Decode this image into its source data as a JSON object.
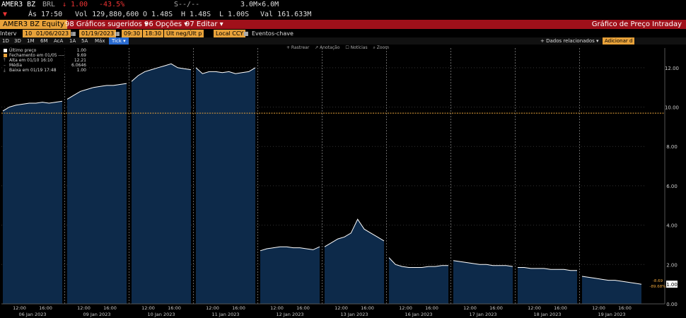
{
  "ticker": {
    "symbol": "AMER3 BZ",
    "currency": "BRL",
    "arrow": "↓",
    "price": "1.00",
    "change_pct": "-43.5%",
    "bid_ask": "S--/--",
    "size": "3.0M×6.0M"
  },
  "row2": {
    "time_label": "Ás 17:50",
    "volume": "Vol 129,880,600",
    "open": "O 1.48S",
    "high": "H 1.48S",
    "low": "L 1.00S",
    "value": "Val 161.633M"
  },
  "titlebar": {
    "security": "AMER3 BZ Equity",
    "menu": [
      "98 Gráficos sugeridos ▾",
      "96 Opções ▾",
      "97 Editar ▾"
    ],
    "title": "Gráfico de Preço Intraday"
  },
  "params": {
    "interval_label": "Interv",
    "interval": "10",
    "start_date": "01/06/2023",
    "end_date": "01/19/2023",
    "start_time": "09:30",
    "end_time": "18:30",
    "price_type": "Últ neg/Últ p",
    "currency": "Local CCY",
    "events": "Eventos-chave"
  },
  "periods": {
    "items": [
      "1D",
      "3D",
      "1M",
      "6M",
      "AcA",
      "1A",
      "5A",
      "Máx"
    ],
    "tick_label": "Tick ▾",
    "related": "+ Dados relacionados ▾",
    "add_label": "Adicionar d"
  },
  "tools": [
    "+ Rastrear",
    "↗ Anotação",
    "☐ Notícias",
    "⌕ Zoom"
  ],
  "legend": [
    {
      "label": "Último preço",
      "value": "1.00",
      "color": "#ffffff"
    },
    {
      "label": "Fechamento em 01/05 ----",
      "value": "9.69",
      "color": "#e8a23a"
    },
    {
      "label": "Alta em 01/10 16:10",
      "value": "12.21",
      "color": "#aaaaaa"
    },
    {
      "label": "Média",
      "value": "6.0646",
      "color": "#aaaaaa"
    },
    {
      "label": "Baixa em 01/19 17:48",
      "value": "1.00",
      "color": "#aaaaaa"
    }
  ],
  "chart_data": {
    "type": "area",
    "ylim": [
      0,
      13
    ],
    "yticks": [
      "0.00",
      "2.00",
      "4.00",
      "6.00",
      "8.00",
      "10.00",
      "12.00"
    ],
    "reference_line": 9.69,
    "last_value_label": "1.00",
    "change_label": "-8.69",
    "change_pct_label": "-89.68%",
    "days": [
      {
        "date": "06 Jan 2023",
        "times": [
          "12:00",
          "16:00"
        ],
        "values": [
          9.8,
          10.0,
          10.1,
          10.15,
          10.2,
          10.2,
          10.25,
          10.2,
          10.25,
          10.3
        ]
      },
      {
        "date": "09 Jan 2023",
        "times": [
          "12:00",
          "16:00"
        ],
        "values": [
          10.4,
          10.6,
          10.8,
          10.9,
          11.0,
          11.05,
          11.1,
          11.1,
          11.15,
          11.2
        ]
      },
      {
        "date": "10 Jan 2023",
        "times": [
          "12:00",
          "16:00"
        ],
        "values": [
          11.3,
          11.6,
          11.8,
          11.9,
          12.0,
          12.1,
          12.2,
          12.0,
          11.95,
          11.9
        ]
      },
      {
        "date": "11 Jan 2023",
        "times": [
          "12:00",
          "16:00"
        ],
        "values": [
          12.0,
          11.7,
          11.8,
          11.8,
          11.75,
          11.8,
          11.7,
          11.75,
          11.8,
          12.0
        ]
      },
      {
        "date": "12 Jan 2023",
        "times": [
          "12:00",
          "16:00"
        ],
        "values": [
          2.7,
          2.8,
          2.85,
          2.9,
          2.9,
          2.85,
          2.85,
          2.8,
          2.75,
          2.9
        ]
      },
      {
        "date": "13 Jan 2023",
        "times": [
          "12:00",
          "16:00"
        ],
        "values": [
          2.9,
          3.1,
          3.3,
          3.4,
          3.6,
          4.3,
          3.8,
          3.6,
          3.4,
          3.2
        ]
      },
      {
        "date": "16 Jan 2023",
        "times": [
          "12:00",
          "16:00"
        ],
        "values": [
          2.35,
          2.0,
          1.9,
          1.85,
          1.85,
          1.85,
          1.9,
          1.9,
          1.95,
          1.95
        ]
      },
      {
        "date": "17 Jan 2023",
        "times": [
          "12:00",
          "16:00"
        ],
        "values": [
          2.2,
          2.15,
          2.1,
          2.05,
          2.0,
          2.0,
          1.95,
          1.95,
          1.95,
          1.9
        ]
      },
      {
        "date": "18 Jan 2023",
        "times": [
          "12:00",
          "16:00"
        ],
        "values": [
          1.85,
          1.85,
          1.8,
          1.8,
          1.8,
          1.75,
          1.75,
          1.75,
          1.7,
          1.7
        ]
      },
      {
        "date": "19 Jan 2023",
        "times": [
          "12:00",
          "16:00"
        ],
        "values": [
          1.4,
          1.35,
          1.3,
          1.25,
          1.2,
          1.2,
          1.15,
          1.1,
          1.05,
          1.0
        ]
      }
    ]
  },
  "colors": {
    "area_fill": "#0d2a4a",
    "line": "#ffffff",
    "reference": "#e8a23a",
    "title_bar": "#a0101a",
    "accent": "#e8a23a"
  }
}
